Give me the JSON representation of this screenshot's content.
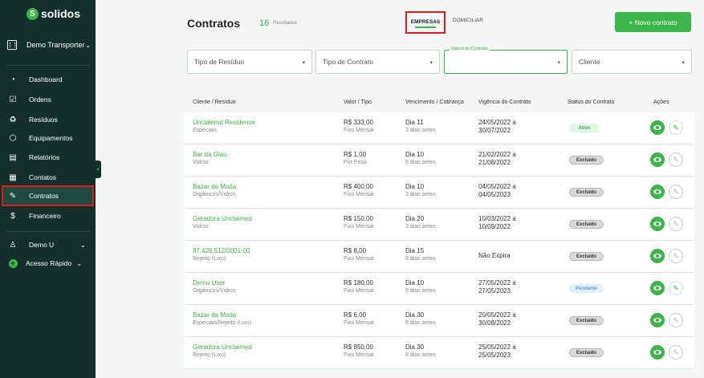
{
  "sidebar": {
    "logo_mark": "S",
    "logo_text": "solidos",
    "company": "Demo Transporter",
    "items": [
      {
        "label": "Dashboard",
        "icon": "dashboard-icon",
        "glyph": "◔"
      },
      {
        "label": "Ordens",
        "icon": "orders-icon",
        "glyph": "☑"
      },
      {
        "label": "Resíduos",
        "icon": "recycle-icon",
        "glyph": "♻"
      },
      {
        "label": "Equipamentos",
        "icon": "equipment-icon",
        "glyph": "⬡"
      },
      {
        "label": "Relatórios",
        "icon": "reports-icon",
        "glyph": "▤"
      },
      {
        "label": "Contatos",
        "icon": "contacts-icon",
        "glyph": "▦"
      },
      {
        "label": "Contratos",
        "icon": "contracts-icon",
        "glyph": "✎"
      },
      {
        "label": "Financeiro",
        "icon": "dollar-icon",
        "glyph": "$"
      }
    ],
    "user": "Demo U",
    "quick_access": "Acesso Rápido"
  },
  "header": {
    "title": "Contratos",
    "count": "16",
    "count_label": "Resultados",
    "tabs": [
      "EMPRESAS",
      "DOMICILIAR"
    ],
    "new_button": "+  Novo contrato"
  },
  "filters": {
    "residuo": "Tipo de Resíduo",
    "contrato": "Tipo de Contrato",
    "status_label": "Status do Contrato",
    "status_value": "",
    "cliente": "Cliente"
  },
  "table": {
    "headers": [
      "Cliente / Resíduo",
      "Valor / Tipo",
      "Vencimento / Cobrança",
      "Vigência do Contrato",
      "Status do Contrato",
      "Ações"
    ],
    "rows": [
      {
        "client": "Unclaiemd Residence",
        "waste": "Especiais",
        "value": "R$ 333,00",
        "type": "Fixo Mensal",
        "due": "Dia 11",
        "charge": "3 dias antes",
        "vig1": "24/05/2022 a",
        "vig2": "30/07/2022",
        "status": "Ativo",
        "status_kind": "ativo",
        "editable": true
      },
      {
        "client": "Bar da Glau",
        "waste": "Vidros",
        "value": "R$ 1,00",
        "type": "Por Peso",
        "due": "Dia 10",
        "charge": "5 dias antes",
        "vig1": "21/02/2022 a",
        "vig2": "21/08/2022",
        "status": "Excluído",
        "status_kind": "excluido",
        "editable": false
      },
      {
        "client": "Bazar da Moda",
        "waste": "Orgânicos/Vidros",
        "value": "R$ 400,00",
        "type": "Fixo Mensal",
        "due": "Dia 10",
        "charge": "3 dias antes",
        "vig1": "04/05/2022 a",
        "vig2": "04/05/2023",
        "status": "Excluído",
        "status_kind": "excluido",
        "editable": false
      },
      {
        "client": "Geradora Unclaimed",
        "waste": "Vidros",
        "value": "R$ 150,00",
        "type": "Fixo Mensal",
        "due": "Dia 20",
        "charge": "3 dias antes",
        "vig1": "10/03/2022 a",
        "vig2": "10/09/2022",
        "status": "Excluído",
        "status_kind": "excluido",
        "editable": false
      },
      {
        "client": "87.426.512/0001-00",
        "waste": "Rejeito (Lixo)",
        "value": "R$ 8,00",
        "type": "Fixo Mensal",
        "due": "Dia 15",
        "charge": "8 dias antes",
        "vig1": "Não Expira",
        "vig2": "",
        "status": "Excluído",
        "status_kind": "excluido",
        "editable": false
      },
      {
        "client": "Demo User",
        "waste": "Orgânicos/Vidros",
        "value": "R$ 180,00",
        "type": "Fixo Mensal",
        "due": "Dia 10",
        "charge": "5 dias antes",
        "vig1": "27/05/2022 a",
        "vig2": "27/05/2023",
        "status": "Pendente",
        "status_kind": "pendente",
        "editable": true
      },
      {
        "client": "Bazar da Moda",
        "waste": "Especiais/Rejeito (Lixo)",
        "value": "R$ 6,00",
        "type": "Fixo Mensal",
        "due": "Dia 30",
        "charge": "8 dias antes",
        "vig1": "20/05/2022 a",
        "vig2": "30/08/2022",
        "status": "Excluído",
        "status_kind": "excluido",
        "editable": false
      },
      {
        "client": "Geradora Unclaimed",
        "waste": "Rejeito (Lixo)",
        "value": "R$ 850,00",
        "type": "Fixo Mensal",
        "due": "Dia 30",
        "charge": "8 dias antes",
        "vig1": "25/05/2022 a",
        "vig2": "25/05/2023",
        "status": "Excluído",
        "status_kind": "excluido",
        "editable": false
      }
    ]
  },
  "colors": {
    "brand": "#3cb54a",
    "sidebar": "#14302a",
    "highlight": "#e01b1b"
  }
}
